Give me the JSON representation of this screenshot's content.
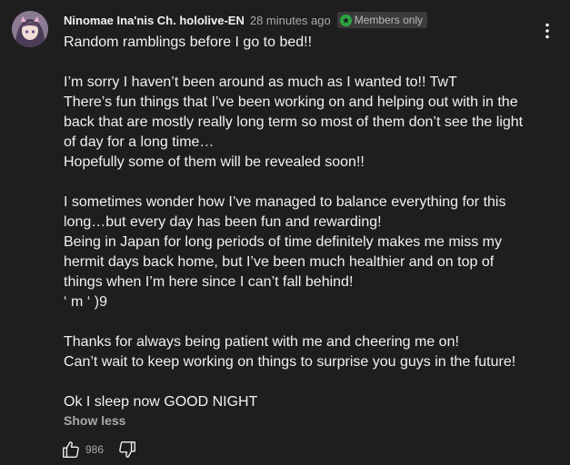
{
  "post": {
    "author": "Ninomae Ina'nis Ch. hololive-EN",
    "time": "28 minutes ago",
    "badge": "Members only",
    "paragraphs": [
      [
        "Random ramblings before I go to bed!!"
      ],
      [
        "I’m sorry I haven’t been around as much as I wanted to!! TwT",
        "There’s fun things that I’ve been working on and helping out with in the",
        "back that are mostly really long term so most of them don’t see the light",
        "of day for a long time…",
        "Hopefully some of them will be revealed soon!!"
      ],
      [
        "I sometimes wonder how I’ve managed to balance everything for this",
        "long…but every day has been fun and rewarding!",
        "Being in Japan for long periods of time definitely makes me miss my",
        "hermit days back home, but I’ve been much healthier and on top of",
        "things when I’m here since I can’t fall behind!",
        "‘ m ‘ )9"
      ],
      [
        "Thanks for always being patient with me and cheering me on!",
        "Can’t wait to keep working on things to surprise you guys in the future!"
      ],
      [
        "Ok I sleep now GOOD NIGHT"
      ]
    ],
    "show_less": "Show less",
    "like_count": "986"
  },
  "colors": {
    "background": "#1e1e1e",
    "text": "#f1f1f1",
    "secondary": "#aaaaaa",
    "badge_bg": "#3a3a3a",
    "badge_icon": "#2ba640"
  },
  "icons": {
    "avatar": "avatar",
    "badge": "members-star-icon",
    "menu": "more-vert-icon",
    "like": "thumbs-up-icon",
    "dislike": "thumbs-down-icon"
  }
}
